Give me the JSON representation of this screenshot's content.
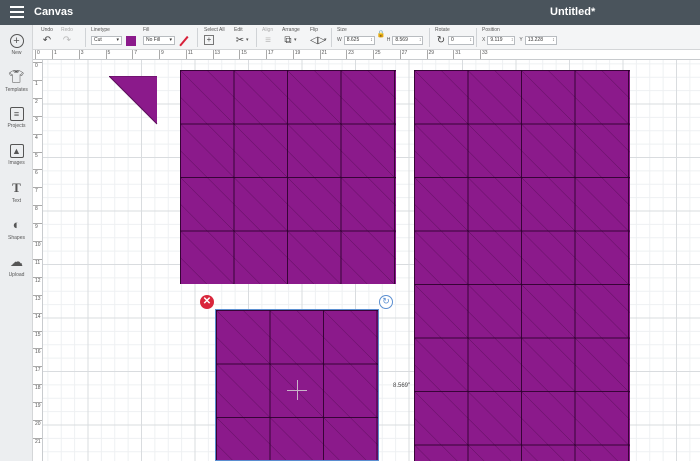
{
  "app": {
    "title": "Canvas",
    "document_title": "Untitled*"
  },
  "toolbar": {
    "undo": "Undo",
    "redo": "Redo",
    "linetype": {
      "label": "Linetype",
      "value": "Cut"
    },
    "fill": {
      "label": "Fill",
      "value": "No Fill"
    },
    "select_all": "Select All",
    "edit": "Edit",
    "align": "Align",
    "arrange": "Arrange",
    "flip": "Flip",
    "size": {
      "label": "Size",
      "w_label": "W",
      "w_value": "8.625",
      "h_label": "H",
      "h_value": "8.569"
    },
    "rotate": {
      "label": "Rotate",
      "value": "0"
    },
    "position": {
      "label": "Position",
      "x_label": "X",
      "x_value": "9.119",
      "y_label": "Y",
      "y_value": "13.228"
    }
  },
  "sidebar": {
    "items": [
      {
        "label": "New",
        "icon": "plus-circle-icon"
      },
      {
        "label": "Templates",
        "icon": "shirt-icon"
      },
      {
        "label": "Projects",
        "icon": "projects-icon"
      },
      {
        "label": "Images",
        "icon": "images-icon"
      },
      {
        "label": "Text",
        "icon": "text-icon"
      },
      {
        "label": "Shapes",
        "icon": "shapes-icon"
      },
      {
        "label": "Upload",
        "icon": "cloud-upload-icon"
      }
    ]
  },
  "ruler": {
    "h_ticks": [
      "0",
      "1",
      "3",
      "5",
      "7",
      "9",
      "11",
      "13",
      "15",
      "17",
      "19",
      "21",
      "23",
      "25",
      "27",
      "29",
      "31",
      "33"
    ],
    "v_ticks": [
      "0",
      "1",
      "2",
      "3",
      "4",
      "5",
      "6",
      "7",
      "8",
      "9",
      "10",
      "11",
      "12",
      "13",
      "14",
      "15",
      "16",
      "17",
      "18",
      "19",
      "20",
      "21"
    ]
  },
  "canvas": {
    "selection_height_label": "8.569\""
  },
  "colors": {
    "accent": "#8b1a8b",
    "topbar": "#4a545c",
    "delete": "#d9273c",
    "selection": "#5b8fd1"
  }
}
